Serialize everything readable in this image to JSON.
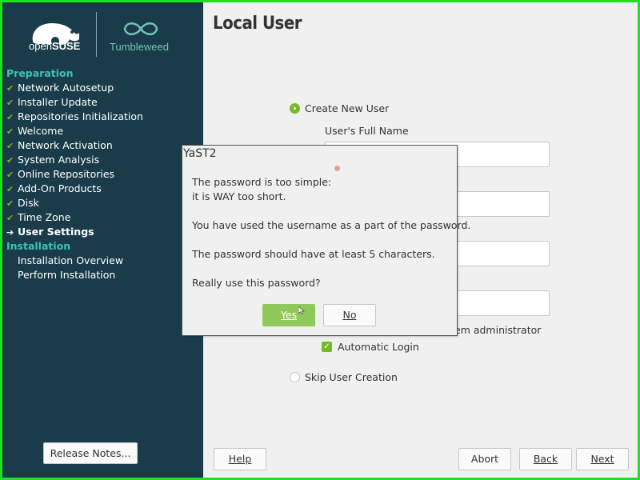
{
  "brand": {
    "open": "open",
    "suse": "SUSE",
    "product": "Tumbleweed",
    "accent_green": "#73ba25",
    "sidebar_bg": "#1a3c4a"
  },
  "sidebar": {
    "sections": [
      {
        "title": "Preparation",
        "steps": [
          {
            "label": "Network Autosetup",
            "state": "done"
          },
          {
            "label": "Installer Update",
            "state": "done"
          },
          {
            "label": "Repositories Initialization",
            "state": "done"
          },
          {
            "label": "Welcome",
            "state": "done"
          },
          {
            "label": "Network Activation",
            "state": "done"
          },
          {
            "label": "System Analysis",
            "state": "done"
          },
          {
            "label": "Online Repositories",
            "state": "done"
          },
          {
            "label": "Add-On Products",
            "state": "done"
          },
          {
            "label": "Disk",
            "state": "done"
          },
          {
            "label": "Time Zone",
            "state": "done"
          },
          {
            "label": "User Settings",
            "state": "current"
          }
        ]
      },
      {
        "title": "Installation",
        "steps": [
          {
            "label": "Installation Overview",
            "state": "pending"
          },
          {
            "label": "Perform Installation",
            "state": "pending"
          }
        ]
      }
    ],
    "release_notes_label": "Release Notes..."
  },
  "main": {
    "title": "Local User",
    "create_new_user_label": "Create New User",
    "full_name_label": "User's Full Name",
    "system_admin_label_visible": "em administrator",
    "automatic_login_label": "Automatic Login",
    "skip_user_creation_label": "Skip User Creation"
  },
  "footer": {
    "help": "Help",
    "abort": "Abort",
    "back": "Back",
    "next": "Next"
  },
  "dialog": {
    "title": "YaST2",
    "line1": "The password is too simple:",
    "line2": "it is WAY too short.",
    "line3": "You have used the username as a part of the password.",
    "line4": "The password should have at least 5 characters.",
    "line5": "Really use this password?",
    "yes": "Yes",
    "no": "No"
  }
}
